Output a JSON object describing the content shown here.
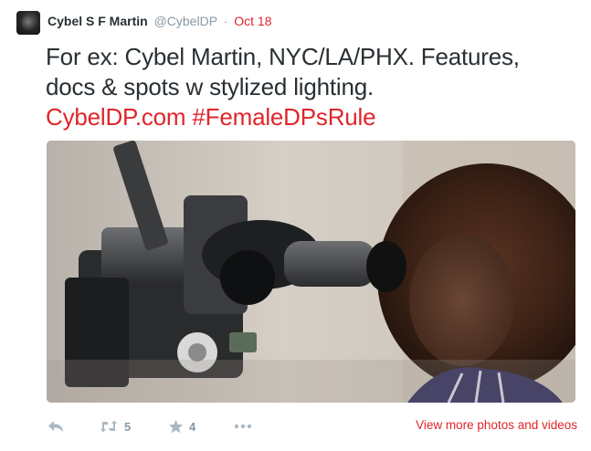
{
  "tweet": {
    "author_name": "Cybel S F Martin",
    "author_handle": "@CybelDP",
    "separator": "·",
    "date": "Oct 18",
    "text_line_1": "For ex: Cybel Martin, NYC/LA/PHX. Features,",
    "text_line_2": "docs & spots w stylized lighting.",
    "link_url": "CybelDP.com",
    "hashtag": "#FemaleDPsRule"
  },
  "actions": {
    "reply_icon": "reply-icon",
    "retweet_icon": "retweet-icon",
    "retweet_count": "5",
    "favorite_icon": "star-icon",
    "favorite_count": "4",
    "more_icon": "ellipsis-icon",
    "view_more_label": "View more photos and videos"
  },
  "colors": {
    "accent": "#e0252b",
    "muted": "#8899a6",
    "text": "#292f33"
  }
}
